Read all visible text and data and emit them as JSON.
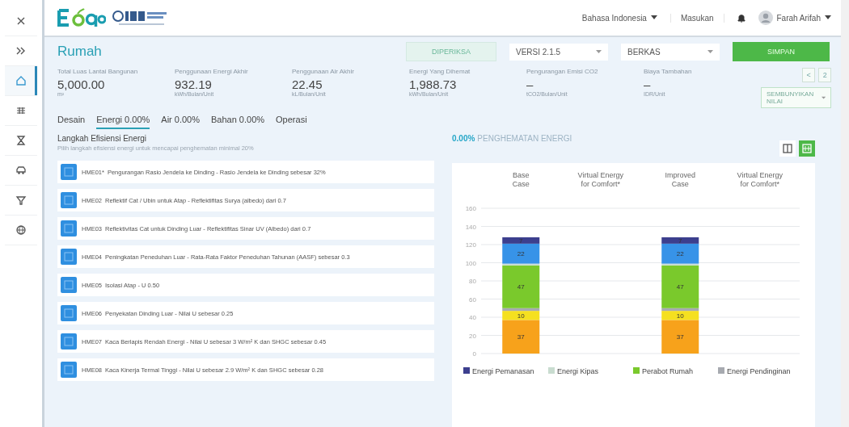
{
  "header": {
    "language": "Bahasa Indonesia",
    "feedback": "Masukan",
    "user": "Farah Arifah"
  },
  "sidebar": {
    "items": [
      {
        "selected": false
      },
      {
        "selected": false
      },
      {
        "selected": true
      },
      {
        "selected": false
      },
      {
        "selected": false
      },
      {
        "selected": false
      },
      {
        "selected": false
      },
      {
        "selected": false
      }
    ]
  },
  "page": {
    "title": "Rumah",
    "status": "DIPERIKSA",
    "version": "VERSI 2.1.5",
    "files": "BERKAS",
    "save": "SIMPAN"
  },
  "metrics": [
    {
      "label": "Total Luas Lantai Bangunan",
      "value": "5,000.00",
      "unit": "m²"
    },
    {
      "label": "Penggunaan Energi Akhir",
      "value": "932.19",
      "unit": "kWh/Bulan/Unit"
    },
    {
      "label": "Penggunaan Air Akhir",
      "value": "22.45",
      "unit": "kL/Bulan/Unit"
    },
    {
      "label": "Energi Yang Dihemat",
      "value": "1,988.73",
      "unit": "kWh/Bulan/Unit"
    },
    {
      "label": "Pengurangan Emisi CO2",
      "value": "–",
      "unit": "tCO2/Bulan/Unit"
    },
    {
      "label": "Biaya Tambahan",
      "value": "–",
      "unit": "IDR/Unit"
    }
  ],
  "pager": {
    "prev": "<",
    "page": "2"
  },
  "subtext_toggle": "SEMBUNYIKAN NILAI",
  "tabs": [
    {
      "label": "Desain",
      "selected": false
    },
    {
      "label": "Energi 0.00%",
      "selected": true
    },
    {
      "label": "Air 0.00%",
      "selected": false
    },
    {
      "label": "Bahan 0.00%",
      "selected": false
    },
    {
      "label": "Operasi",
      "selected": false
    }
  ],
  "measures_panel": {
    "title": "Langkah Efisiensi Energi",
    "note": "Pilih langkah efisiensi energi untuk mencapai penghematan minimal 20%",
    "items": [
      {
        "code": "HME01*",
        "text": "Pengurangan Rasio Jendela ke Dinding - Rasio Jendela ke Dinding sebesar 32%"
      },
      {
        "code": "HME02",
        "text": "Reflektif Cat / Ubin untuk Atap - Reflektifitas Surya (albedo) dari 0.7"
      },
      {
        "code": "HME03",
        "text": "Reflektivitas Cat untuk Dinding Luar - Reflektifitas Sinar UV (Albedo) dari 0.7"
      },
      {
        "code": "HME04",
        "text": "Peningkatan Peneduhan Luar - Rata-Rata Faktor Peneduhan Tahunan (AASF) sebesar 0.3"
      },
      {
        "code": "HME05",
        "text": "Isolasi Atap - U 0.50"
      },
      {
        "code": "HME06",
        "text": "Penyekatan Dinding Luar - Nilai U sebesar 0.25"
      },
      {
        "code": "HME07",
        "text": "Kaca Berlapis Rendah Energi - Nilai U sebesar 3 W/m² K dan SHGC sebesar 0.45"
      },
      {
        "code": "HME08",
        "text": "Kaca Kinerja Termal Tinggi - Nilai U sebesar 2.9 W/m² K dan SHGC sebesar 0.28"
      }
    ]
  },
  "savings": {
    "percent": "0.00%",
    "label": "PENGHEMATAN ENERGI",
    "views": [
      {
        "selected": false
      },
      {
        "selected": true
      }
    ]
  },
  "chart_data": {
    "type": "bar",
    "stacked": true,
    "grid": true,
    "legend": "bottom",
    "categories": [
      "Base Case",
      "Virtual Energy for Comfort*",
      "Improved Case",
      "Virtual Energy for Comfort*"
    ],
    "ylim": [
      0,
      160
    ],
    "yticks": [
      0,
      20,
      40,
      60,
      80,
      100,
      120,
      140,
      160
    ],
    "series": [
      {
        "color": "#f7a21b",
        "values": [
          37,
          null,
          37,
          null
        ],
        "value_labels": [
          "37",
          null,
          "37",
          null
        ]
      },
      {
        "color": "#f5e020",
        "values": [
          10,
          null,
          10,
          null
        ],
        "value_labels": [
          "10",
          null,
          "10",
          null
        ]
      },
      {
        "name": "Energi Pendinginan",
        "color": "#a7aab0",
        "values": [
          3,
          null,
          3,
          null
        ]
      },
      {
        "name": "Perabot Rumah",
        "color": "#7ac92c",
        "values": [
          47,
          null,
          47,
          null
        ],
        "value_labels": [
          "47",
          null,
          "47",
          null
        ]
      },
      {
        "name": "Energi Kipas",
        "color": "#c9dcd0",
        "values": [
          2,
          null,
          2,
          null
        ]
      },
      {
        "color": "#3793e8",
        "values": [
          22,
          null,
          22,
          null
        ],
        "value_labels": [
          "22",
          null,
          "22",
          null
        ]
      },
      {
        "name": "Energi Pemanasan",
        "color": "#3c3f8e",
        "values": [
          7,
          null,
          7,
          null
        ],
        "value_labels": [
          "7",
          null,
          "7",
          null
        ]
      }
    ]
  }
}
